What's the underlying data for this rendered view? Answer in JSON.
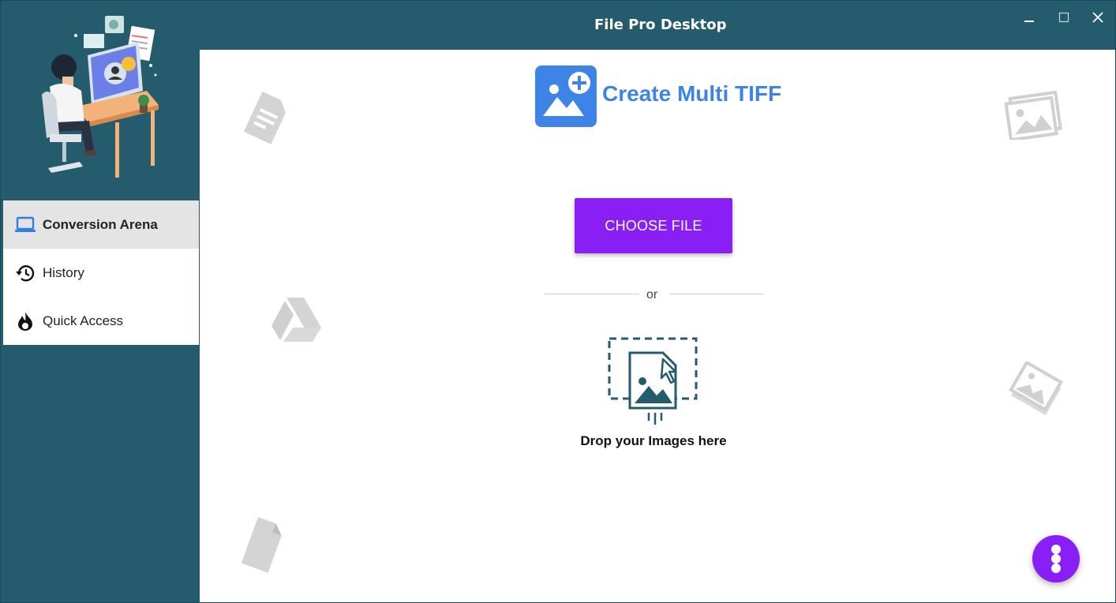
{
  "window": {
    "title": "File Pro Desktop",
    "controls": [
      "minimize",
      "maximize",
      "close"
    ]
  },
  "sidebar": {
    "items": [
      {
        "label": "Conversion Arena",
        "icon": "laptop-icon",
        "active": true
      },
      {
        "label": "History",
        "icon": "history-icon",
        "active": false
      },
      {
        "label": "Quick Access",
        "icon": "flame-icon",
        "active": false
      }
    ]
  },
  "main": {
    "title": "Create Multi TIFF",
    "choose_button": "CHOOSE FILE",
    "or_label": "or",
    "drop_label": "Drop your Images here",
    "more_button_icon": "vertical-dots-icon"
  },
  "colors": {
    "sidebar_bg": "#245b6d",
    "accent_purple": "#8a1ff5",
    "title_blue": "#3d84e6",
    "active_nav_bg": "#e4e4e4"
  }
}
